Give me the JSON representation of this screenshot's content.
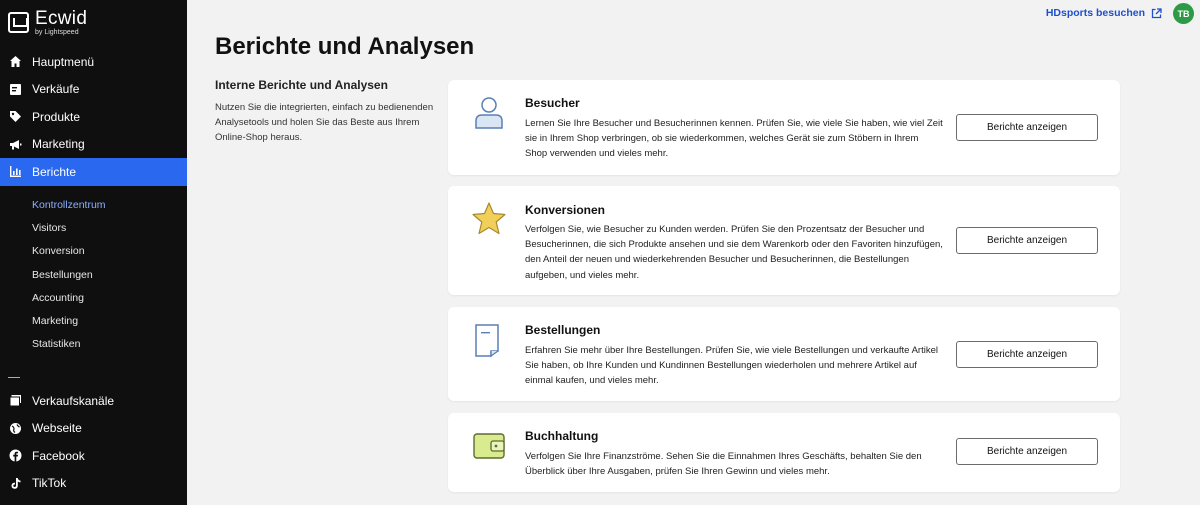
{
  "app": {
    "name": "Ecwid",
    "byline": "by Lightspeed"
  },
  "nav": {
    "items": [
      {
        "label": "Hauptmenü",
        "icon": "home-icon"
      },
      {
        "label": "Verkäufe",
        "icon": "sales-icon"
      },
      {
        "label": "Produkte",
        "icon": "tag-icon"
      },
      {
        "label": "Marketing",
        "icon": "megaphone-icon"
      },
      {
        "label": "Berichte",
        "icon": "chart-icon",
        "active": true
      }
    ],
    "sub_items": [
      {
        "label": "Kontrollzentrum",
        "active": true
      },
      {
        "label": "Visitors"
      },
      {
        "label": "Konversion"
      },
      {
        "label": "Bestellungen"
      },
      {
        "label": "Accounting"
      },
      {
        "label": "Marketing"
      },
      {
        "label": "Statistiken"
      }
    ],
    "channels": [
      {
        "label": "Verkaufskanäle",
        "icon": "channels-icon"
      },
      {
        "label": "Webseite",
        "icon": "globe-icon"
      },
      {
        "label": "Facebook",
        "icon": "facebook-icon"
      },
      {
        "label": "TikTok",
        "icon": "tiktok-icon"
      }
    ]
  },
  "header": {
    "visit_link": "HDsports besuchen",
    "avatar_initials": "TB",
    "avatar_color": "#2f9a45"
  },
  "page": {
    "title": "Berichte und Analysen",
    "intro_title": "Interne Berichte und Analysen",
    "intro_text": "Nutzen Sie die integrierten, einfach zu bedienenden Analysetools und holen Sie das Beste aus Ihrem Online-Shop heraus."
  },
  "cards": [
    {
      "title": "Besucher",
      "icon": "visitor-icon",
      "text": "Lernen Sie Ihre Besucher und Besucherinnen kennen. Prüfen Sie, wie viele Sie haben, wie viel Zeit sie in Ihrem Shop verbringen, ob sie wiederkommen, welches Gerät sie zum Stöbern in Ihrem Shop verwenden und vieles mehr.",
      "button": "Berichte anzeigen"
    },
    {
      "title": "Konversionen",
      "icon": "star-icon",
      "text": "Verfolgen Sie, wie Besucher zu Kunden werden. Prüfen Sie den Prozentsatz der Besucher und Besucherinnen, die sich Produkte ansehen und sie dem Warenkorb oder den Favoriten hinzufügen, den Anteil der neuen und wiederkehrenden Besucher und Besucherinnen, die Bestellungen aufgeben, und vieles mehr.",
      "button": "Berichte anzeigen"
    },
    {
      "title": "Bestellungen",
      "icon": "receipt-icon",
      "text": "Erfahren Sie mehr über Ihre Bestellungen. Prüfen Sie, wie viele Bestellungen und verkaufte Artikel Sie haben, ob Ihre Kunden und Kundinnen Bestellungen wiederholen und mehrere Artikel auf einmal kaufen, und vieles mehr.",
      "button": "Berichte anzeigen"
    },
    {
      "title": "Buchhaltung",
      "icon": "wallet-icon",
      "text": "Verfolgen Sie Ihre Finanzströme. Sehen Sie die Einnahmen Ihres Geschäfts, behalten Sie den Überblick über Ihre Ausgaben, prüfen Sie Ihren Gewinn und vieles mehr.",
      "button": "Berichte anzeigen"
    }
  ]
}
